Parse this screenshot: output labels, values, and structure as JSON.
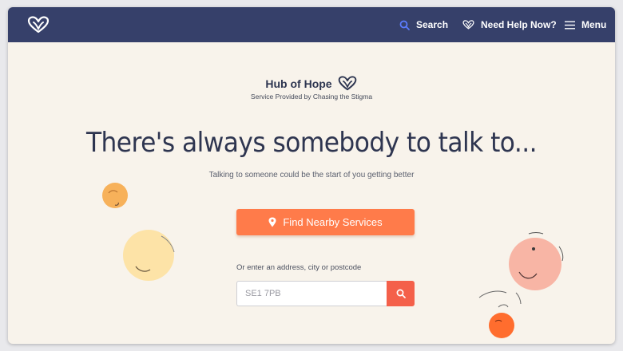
{
  "navbar": {
    "logo_icon": "heart-outline-icon",
    "search_label": "Search",
    "help_label": "Need Help Now?",
    "menu_label": "Menu",
    "background": "#36406a"
  },
  "brand": {
    "name": "Hub of Hope",
    "subtitle": "Service Provided by Chasing the Stigma"
  },
  "hero": {
    "headline": "There's always somebody to talk to...",
    "subline": "Talking to someone could be the start of you getting better"
  },
  "find_button": {
    "label": "Find Nearby Services",
    "icon": "map-pin-icon",
    "color": "#ff7b4a"
  },
  "address": {
    "label": "Or enter an address, city or postcode",
    "placeholder": "SE1 7PB"
  },
  "search_button": {
    "icon": "search-icon",
    "color": "#f4604a"
  },
  "colors": {
    "page_background": "#f8f3eb",
    "text_dark": "#2e3550"
  }
}
